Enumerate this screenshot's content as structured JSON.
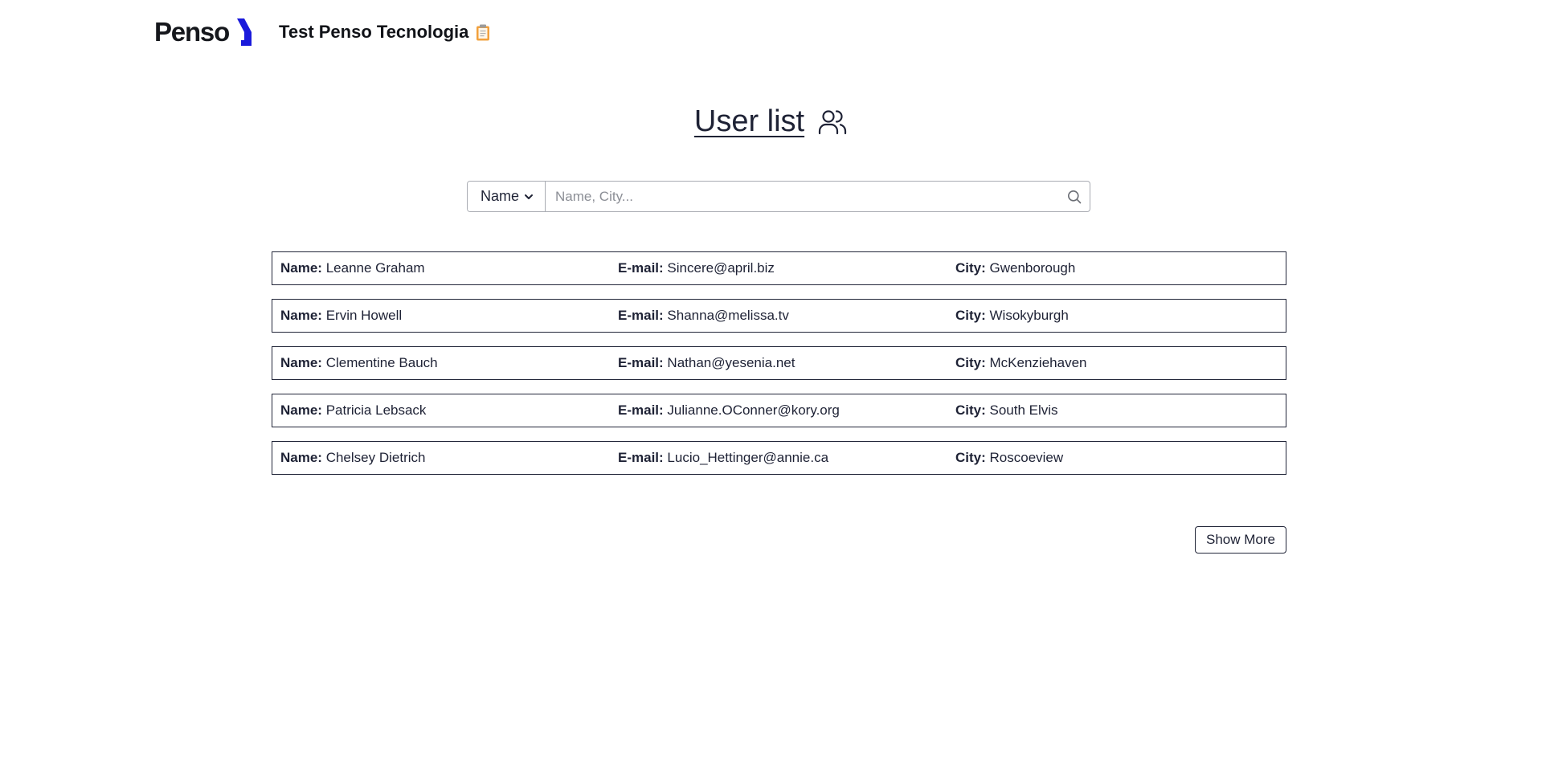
{
  "header": {
    "logo_text": "Penso",
    "title": "Test Penso Tecnologia",
    "brand_color": "#1a1adb",
    "clipboard_icon": "clipboard-icon"
  },
  "main": {
    "title": "User list",
    "title_icon": "users-icon"
  },
  "search": {
    "filter_selected": "Name",
    "placeholder": "Name, City...",
    "icon": "search-icon"
  },
  "labels": {
    "name": "Name:",
    "email": "E-mail:",
    "city": "City:"
  },
  "users": [
    {
      "name": "Leanne Graham",
      "email": "Sincere@april.biz",
      "city": "Gwenborough"
    },
    {
      "name": "Ervin Howell",
      "email": "Shanna@melissa.tv",
      "city": "Wisokyburgh"
    },
    {
      "name": "Clementine Bauch",
      "email": "Nathan@yesenia.net",
      "city": "McKenziehaven"
    },
    {
      "name": "Patricia Lebsack",
      "email": "Julianne.OConner@kory.org",
      "city": "South Elvis"
    },
    {
      "name": "Chelsey Dietrich",
      "email": "Lucio_Hettinger@annie.ca",
      "city": "Roscoeview"
    }
  ],
  "show_more_label": "Show More"
}
